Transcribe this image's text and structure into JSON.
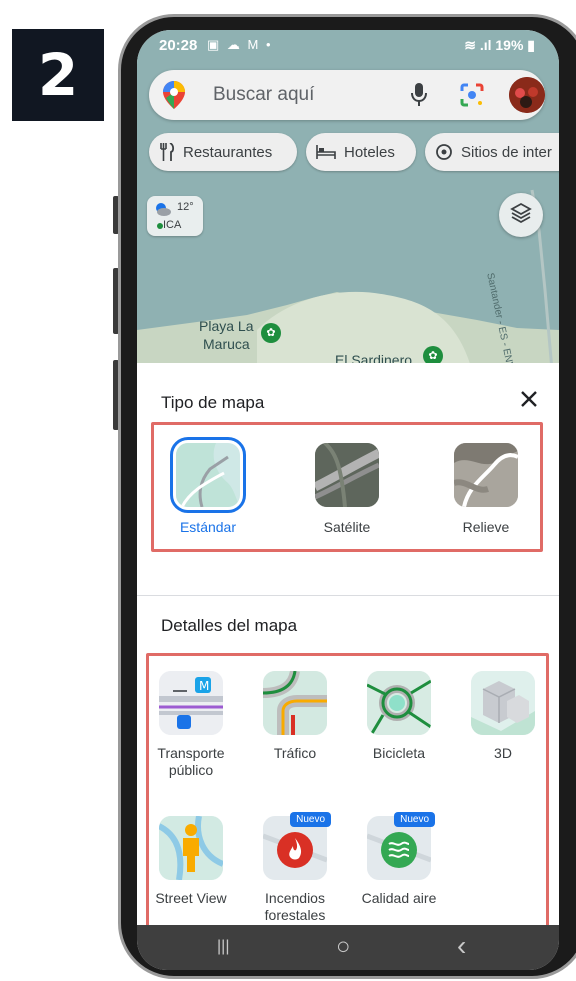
{
  "step": "2",
  "status": {
    "time": "20:28",
    "icons_left": "▣ ☁ M •",
    "battery": "19%"
  },
  "search": {
    "placeholder": "Buscar aquí"
  },
  "chips": [
    {
      "label": "Restaurantes",
      "icon": "fork-knife-icon"
    },
    {
      "label": "Hoteles",
      "icon": "bed-icon"
    },
    {
      "label": "Sitios de inter",
      "icon": "landmark-icon"
    }
  ],
  "weather": {
    "temp": "12°",
    "ica": "ICA"
  },
  "map_labels": {
    "beach": "Playa La",
    "beach2": "Maruca",
    "place": "El Sardinero",
    "street": "Santander - ES - ENVIDO"
  },
  "map_type": {
    "title": "Tipo de mapa",
    "options": [
      {
        "label": "Estándar",
        "selected": true
      },
      {
        "label": "Satélite",
        "selected": false
      },
      {
        "label": "Relieve",
        "selected": false
      }
    ]
  },
  "map_details": {
    "title": "Detalles del mapa",
    "options": [
      {
        "label": "Transporte público"
      },
      {
        "label": "Tráfico"
      },
      {
        "label": "Bicicleta"
      },
      {
        "label": "3D"
      },
      {
        "label": "Street View"
      },
      {
        "label": "Incendios forestales",
        "badge": "Nuevo"
      },
      {
        "label": "Calidad aire",
        "badge": "Nuevo"
      }
    ]
  },
  "nav": {
    "recents": "|||",
    "home": "○",
    "back": "‹"
  },
  "colors": {
    "highlight": "#e06b66",
    "accent": "#1a73e8"
  }
}
